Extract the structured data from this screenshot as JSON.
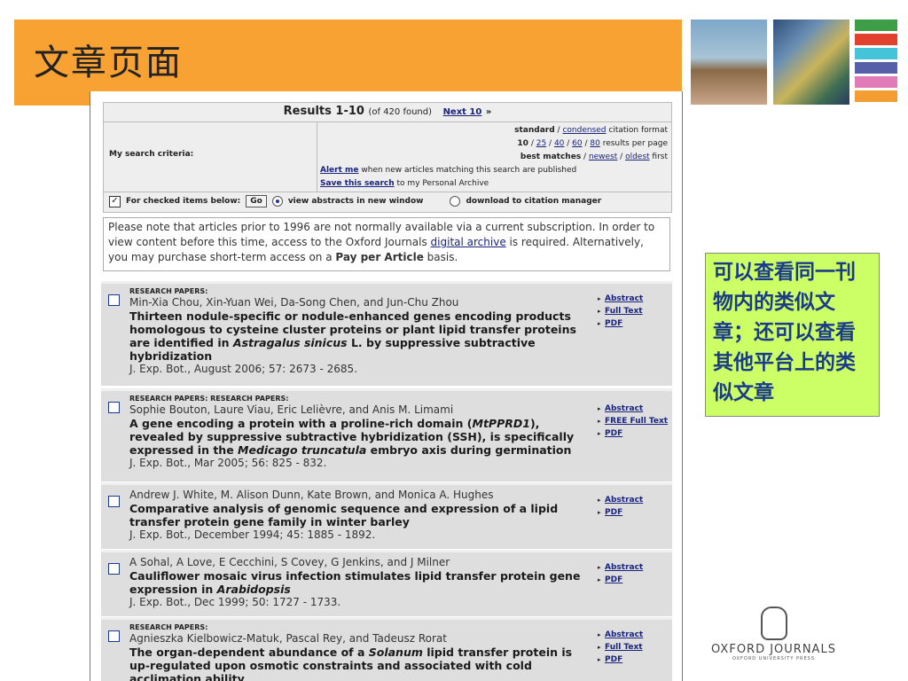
{
  "slide": {
    "title": "文章页面",
    "callout": "可以查看同一刊物内的类似文章；还可以查看其他平台上的类似文章"
  },
  "colors": {
    "header_band": "#f8a234",
    "callout_bg": "#ccff66",
    "callout_text": "#1a3a8a",
    "stripes": [
      "#3d9e47",
      "#e2412d",
      "#45c3d8",
      "#5560a9",
      "#e07bb8",
      "#f39d33"
    ]
  },
  "results": {
    "title": "Results 1-10",
    "found": "(of 420 found)",
    "next_link": "Next 10",
    "next_arrow": "»",
    "criteria_label": "My search criteria:",
    "format": {
      "standard": "standard",
      "sep1": " / ",
      "condensed": "condensed",
      "suffix": " citation format"
    },
    "per_page": {
      "current": "10",
      "opt25": "25",
      "opt40": "40",
      "opt60": "60",
      "opt80": "80",
      "suffix": " results per page"
    },
    "sort": {
      "current": "best matches",
      "newest": "newest",
      "oldest": "oldest",
      "suffix": " first"
    },
    "alert_link": "Alert me",
    "alert_text": " when new articles matching this search are published",
    "save_link": "Save this search",
    "save_text": " to my Personal Archive",
    "checked_label": "For checked items below:",
    "go_label": "Go",
    "view_abstracts_label": "view abstracts in new window",
    "download_label": "download to citation manager"
  },
  "notice": {
    "text_before": "Please note that articles prior to 1996 are not normally available via a current subscription. In order to view content before this time, access to the Oxford Journals ",
    "link": "digital archive",
    "text_mid": " is required. Alternatively, you may purchase short-term access on a ",
    "bold": "Pay per Article",
    "text_after": " basis."
  },
  "items": [
    {
      "section": "RESEARCH PAPERS:",
      "authors": "Min-Xia Chou, Xin-Yuan Wei, Da-Song Chen, and Jun-Chu Zhou",
      "title_before": "Thirteen nodule-specific or nodule-enhanced genes encoding products homologous to cysteine cluster proteins or plant lipid transfer proteins are identified in ",
      "title_italic": "Astragalus sinicus",
      "title_after": " L. by suppressive subtractive hybridization",
      "citation": "J. Exp. Bot., August 2006; 57: 2673 - 2685.",
      "links": [
        "Abstract",
        "Full Text",
        "PDF"
      ]
    },
    {
      "section": "RESEARCH PAPERS: RESEARCH PAPERS:",
      "authors": "Sophie Bouton, Laure Viau, Eric Lelièvre, and Anis M. Limami",
      "title_before": "A gene encoding a protein with a proline-rich domain (",
      "title_italic": "MtPPRD1",
      "title_mid": "), revealed by suppressive subtractive hybridization (SSH), is specifically expressed in the ",
      "title_italic2": "Medicago truncatula",
      "title_after": " embryo axis during germination",
      "citation": "J. Exp. Bot., Mar 2005; 56: 825 - 832.",
      "links": [
        "Abstract",
        "FREE Full Text",
        "PDF"
      ]
    },
    {
      "section": "",
      "authors": "Andrew J. White, M. Alison Dunn, Kate Brown, and Monica A. Hughes",
      "title_before": "Comparative analysis of genomic sequence and expression of a lipid transfer protein gene family in winter barley",
      "citation": "J. Exp. Bot., December 1994; 45: 1885 - 1892.",
      "links": [
        "Abstract",
        "PDF"
      ]
    },
    {
      "section": "",
      "authors": "A Sohal, A Love, E Cecchini, S Covey, G Jenkins, and J Milner",
      "title_before": "Cauliflower mosaic virus infection stimulates lipid transfer protein gene expression in ",
      "title_italic": "Arabidopsis",
      "citation": "J. Exp. Bot., Dec 1999; 50: 1727 - 1733.",
      "links": [
        "Abstract",
        "PDF"
      ]
    },
    {
      "section": "RESEARCH PAPERS:",
      "authors": "Agnieszka Kielbowicz-Matuk, Pascal Rey, and Tadeusz Rorat",
      "title_before": "The organ-dependent abundance of a ",
      "title_italic": "Solanum",
      "title_after": " lipid transfer protein is up-regulated upon osmotic constraints and associated with cold acclimation ability",
      "citation": "",
      "links": [
        "Abstract",
        "Full Text",
        "PDF"
      ]
    }
  ],
  "logo": {
    "name": "OXFORD JOURNALS",
    "sub": "OXFORD UNIVERSITY PRESS"
  }
}
